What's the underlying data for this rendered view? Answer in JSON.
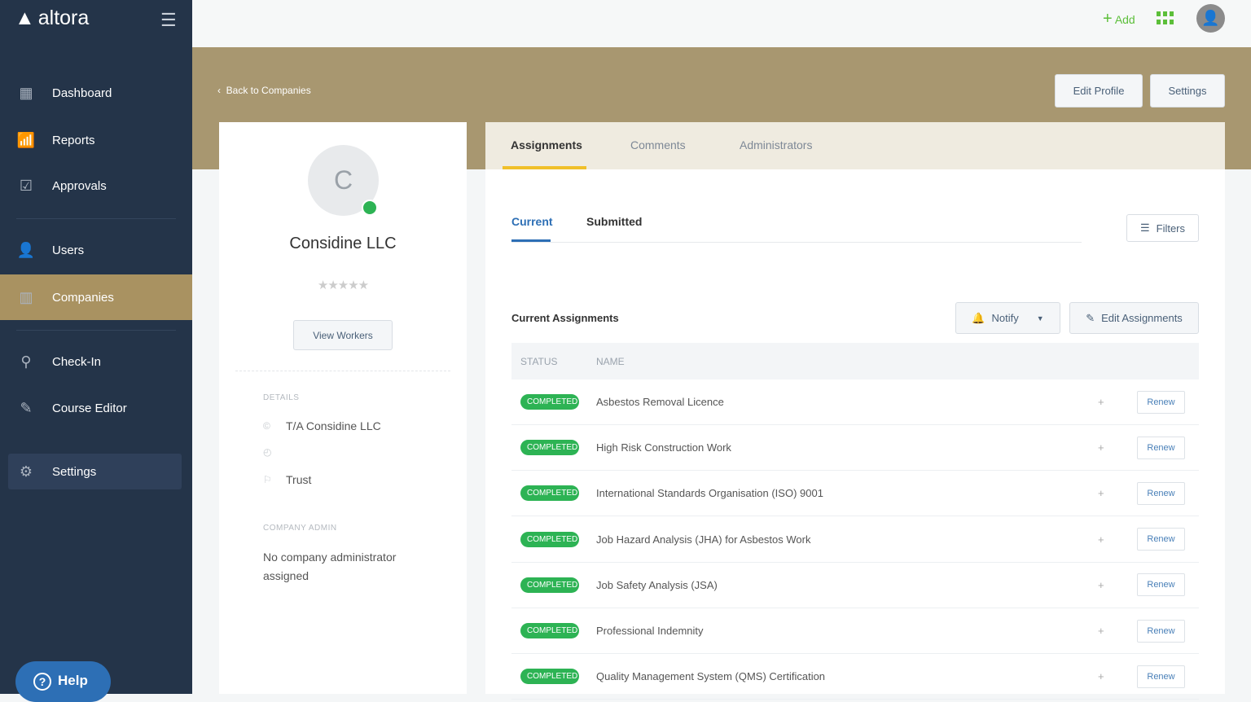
{
  "brand": {
    "name": "altora"
  },
  "sidebar": {
    "items": [
      {
        "label": "Dashboard",
        "icon": "dashboard-icon"
      },
      {
        "label": "Reports",
        "icon": "bar-chart-icon"
      },
      {
        "label": "Approvals",
        "icon": "checkbox-icon"
      },
      {
        "label": "Users",
        "icon": "user-icon"
      },
      {
        "label": "Companies",
        "icon": "building-icon",
        "active": true
      },
      {
        "label": "Check-In",
        "icon": "location-pin-icon"
      },
      {
        "label": "Course Editor",
        "icon": "edit-document-icon"
      },
      {
        "label": "Settings",
        "icon": "gear-icon"
      }
    ],
    "help": "Help"
  },
  "topbar": {
    "add": "Add"
  },
  "header": {
    "back": "Back to Companies",
    "edit_profile": "Edit Profile",
    "settings": "Settings"
  },
  "company": {
    "initial": "C",
    "name": "Considine LLC",
    "rating": 0,
    "stars": "★★★★★",
    "view_workers": "View Workers",
    "details_label": "DETAILS",
    "trading_name": "T/A Considine LLC",
    "website": "",
    "type": "Trust",
    "admin_label": "COMPANY ADMIN",
    "admin_value": "No company administrator assigned"
  },
  "tabs": [
    "Assignments",
    "Comments",
    "Administrators"
  ],
  "subtabs": [
    "Current",
    "Submitted"
  ],
  "filters": "Filters",
  "assignments": {
    "title": "Current Assignments",
    "notify": "Notify",
    "edit": "Edit Assignments",
    "columns": [
      "STATUS",
      "NAME"
    ],
    "rows": [
      {
        "status": "COMPLETED",
        "name": "Asbestos Removal Licence",
        "action": "Renew"
      },
      {
        "status": "COMPLETED",
        "name": "High Risk Construction Work",
        "action": "Renew"
      },
      {
        "status": "COMPLETED",
        "name": "International Standards Organisation (ISO) 9001",
        "action": "Renew"
      },
      {
        "status": "COMPLETED",
        "name": "Job Hazard Analysis (JHA) for Asbestos Work",
        "action": "Renew"
      },
      {
        "status": "COMPLETED",
        "name": "Job Safety Analysis (JSA)",
        "action": "Renew"
      },
      {
        "status": "COMPLETED",
        "name": "Professional Indemnity",
        "action": "Renew"
      },
      {
        "status": "COMPLETED",
        "name": "Quality Management System (QMS) Certification",
        "action": "Renew"
      }
    ]
  },
  "colors": {
    "sidebar": "#243449",
    "accent": "#a99261",
    "green": "#2db354",
    "tab_underline": "#f0c02a",
    "link": "#2d6fb5"
  }
}
